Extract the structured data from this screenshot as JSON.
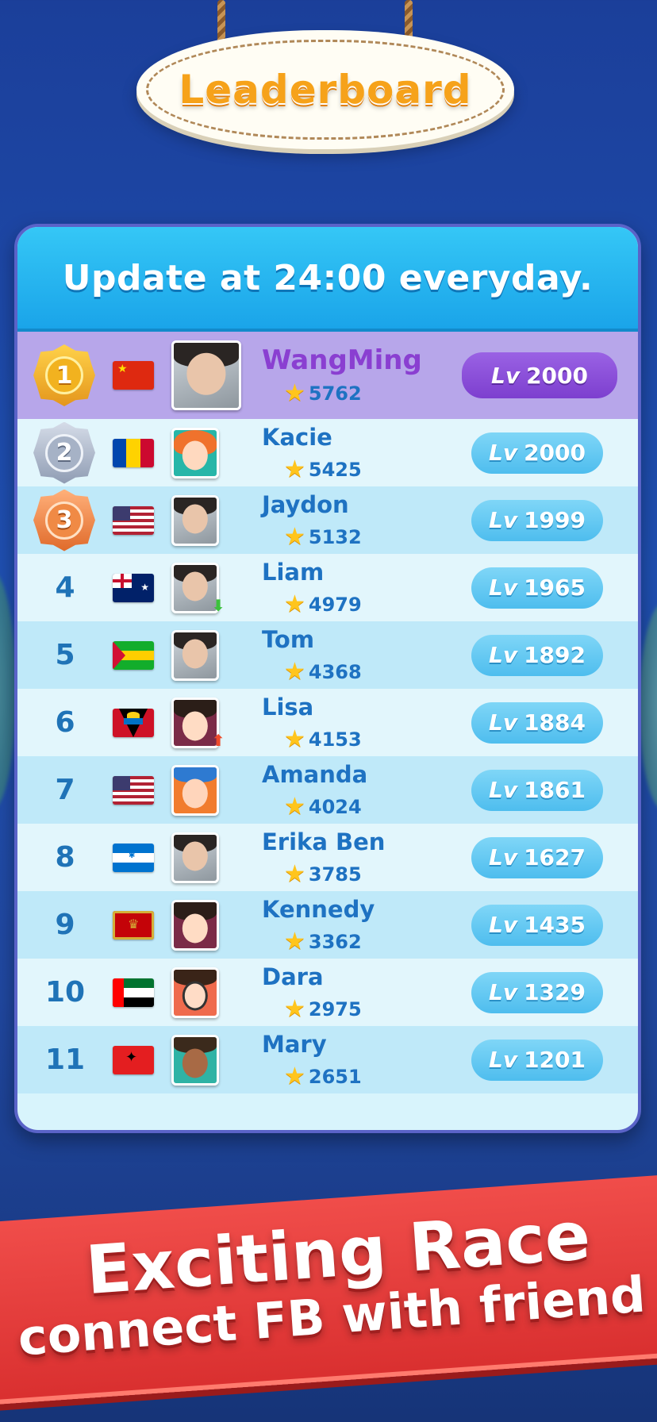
{
  "header": {
    "title": "Leaderboard"
  },
  "board": {
    "update_note": "Update at 24:00 everyday."
  },
  "level_prefix": "Lv",
  "players": [
    {
      "rank": "1",
      "name": "WangMing",
      "score": "5762",
      "level": "2000",
      "flag": "china",
      "avatar_style": "photo",
      "trend": ""
    },
    {
      "rank": "2",
      "name": "Kacie",
      "score": "5425",
      "level": "2000",
      "flag": "moldova",
      "avatar_style": "cartoon-girl-orange-hair",
      "trend": ""
    },
    {
      "rank": "3",
      "name": "Jaydon",
      "score": "5132",
      "level": "1999",
      "flag": "usa",
      "avatar_style": "photo",
      "trend": ""
    },
    {
      "rank": "4",
      "name": "Liam",
      "score": "4979",
      "level": "1965",
      "flag": "australia",
      "avatar_style": "photo",
      "trend": "down"
    },
    {
      "rank": "5",
      "name": "Tom",
      "score": "4368",
      "level": "1892",
      "flag": "sao-tome",
      "avatar_style": "photo",
      "trend": ""
    },
    {
      "rank": "6",
      "name": "Lisa",
      "score": "4153",
      "level": "1884",
      "flag": "antigua",
      "avatar_style": "cartoon-boy",
      "trend": "up"
    },
    {
      "rank": "7",
      "name": "Amanda",
      "score": "4024",
      "level": "1861",
      "flag": "usa",
      "avatar_style": "cartoon-girl-cap",
      "trend": ""
    },
    {
      "rank": "8",
      "name": "Erika Ben",
      "score": "3785",
      "level": "1627",
      "flag": "honduras",
      "avatar_style": "photo",
      "trend": ""
    },
    {
      "rank": "9",
      "name": "Kennedy",
      "score": "3362",
      "level": "1435",
      "flag": "montenegro",
      "avatar_style": "cartoon-boy",
      "trend": ""
    },
    {
      "rank": "10",
      "name": "Dara",
      "score": "2975",
      "level": "1329",
      "flag": "uae",
      "avatar_style": "cartoon-girl-glasses",
      "trend": ""
    },
    {
      "rank": "11",
      "name": "Mary",
      "score": "2651",
      "level": "1201",
      "flag": "albania",
      "avatar_style": "cartoon-girl-dark",
      "trend": ""
    }
  ],
  "banner": {
    "line1": "Exciting Race",
    "line2": "connect FB with friend"
  },
  "colors": {
    "accent_purple": "#8a3fd1",
    "accent_blue": "#1e72c2",
    "banner_red": "#e23b39"
  }
}
